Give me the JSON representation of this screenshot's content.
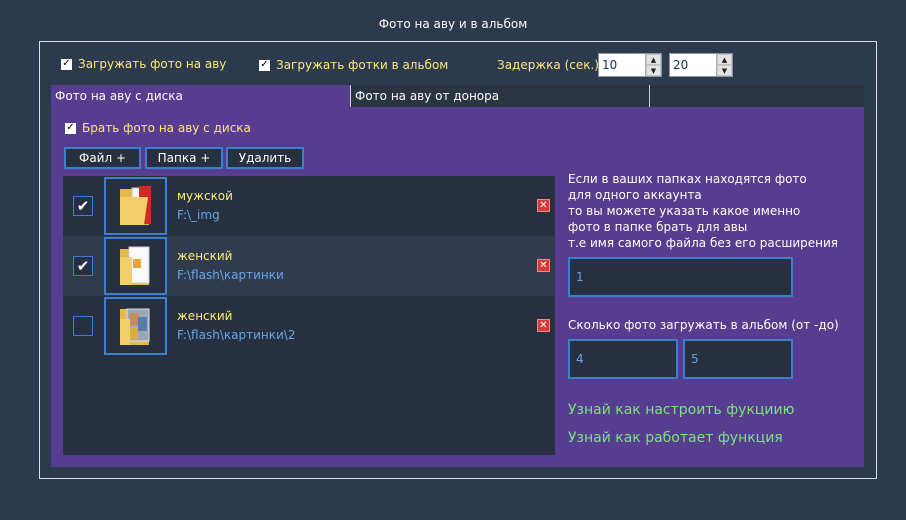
{
  "window": {
    "title": "Фото на аву и в альбом"
  },
  "top": {
    "upload_avatar_label": "Загружать фото на аву",
    "upload_avatar_checked": true,
    "upload_album_label": "Загружать фотки в альбом",
    "upload_album_checked": true,
    "delay_label": "Задержка (сек.)",
    "delay_from": "10",
    "delay_to": "20"
  },
  "tabs": [
    {
      "label": "Фото на аву с диска",
      "active": true
    },
    {
      "label": "Фото на аву от донора",
      "active": false
    }
  ],
  "panel": {
    "take_from_disk_label": "Брать фото на аву с диска",
    "take_from_disk_checked": true,
    "buttons": {
      "file": "Файл +",
      "folder": "Папка +",
      "delete": "Удалить"
    },
    "folders": [
      {
        "name": "мужской",
        "path": "F:\\_img",
        "checked": true,
        "icon": "folder-red-icon"
      },
      {
        "name": "женский",
        "path": "F:\\flash\\картинки",
        "checked": true,
        "icon": "folder-document-icon"
      },
      {
        "name": "женский",
        "path": "F:\\flash\\картинки\\2",
        "checked": false,
        "icon": "folder-photo-icon"
      }
    ],
    "help_lines": [
      "Если в ваших папках находятся фото",
      "для одного аккаунта",
      "то вы можете указать какое именно",
      "фото в папке брать для авы",
      "т.е имя самого файла без его расширения"
    ],
    "filename_value": "1",
    "count_label": "Сколько фото загружать в альбом (от -до)",
    "count_from": "4",
    "count_to": "5",
    "link_setup": "Узнай как настроить фукциию",
    "link_how": "Узнай как работает функция"
  },
  "colors": {
    "background": "#2b3a4c",
    "panel": "#573d8f",
    "list": "#273040",
    "accent_border": "#3f7fcf",
    "label_yellow": "#ffe97a",
    "path_blue": "#6aa6e6",
    "link_green": "#7ee37e",
    "delete_red": "#d83a3a"
  }
}
